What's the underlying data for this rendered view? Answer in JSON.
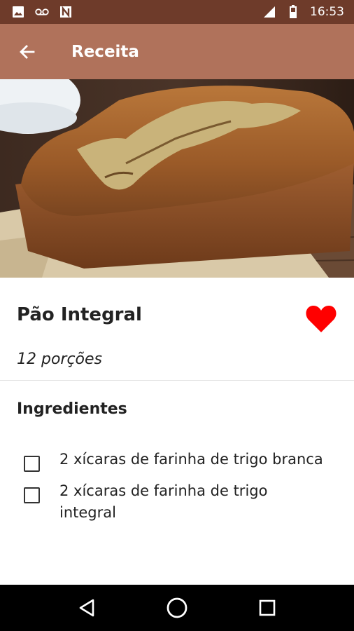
{
  "status_bar": {
    "time": "16:53",
    "icons": [
      "image-icon",
      "voicemail-icon",
      "n-icon",
      "signal-icon",
      "battery-icon"
    ],
    "background": "#6e3b2a"
  },
  "app_bar": {
    "title": "Receita",
    "back_icon": "arrow-back-icon",
    "background": "#b0725b"
  },
  "recipe": {
    "image_alt": "loaf of whole wheat bread",
    "title": "Pão Integral",
    "favorite_icon": "heart-icon",
    "favorite_color": "#ff0000",
    "portions": "12 porções"
  },
  "ingredients": {
    "heading": "Ingredientes",
    "items": [
      {
        "text": "2 xícaras de farinha de trigo branca",
        "checked": false
      },
      {
        "text": "2 xícaras de farinha de trigo integral",
        "checked": false
      }
    ]
  },
  "nav_bar": {
    "back": "triangle-back-icon",
    "home": "circle-home-icon",
    "recents": "square-recents-icon"
  }
}
